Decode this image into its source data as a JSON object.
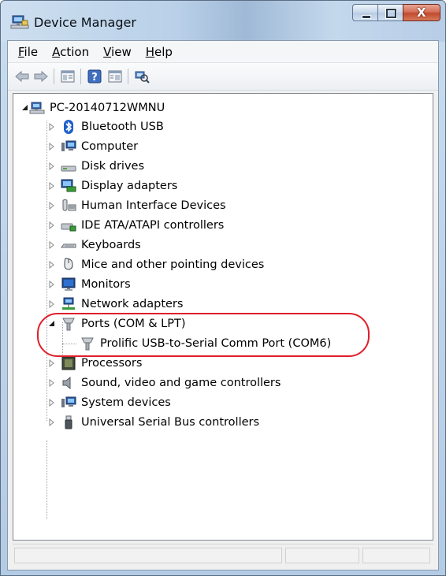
{
  "window": {
    "title": "Device Manager",
    "icons": {
      "title": "device-manager-icon"
    }
  },
  "caption_buttons": {
    "close_glyph": "X"
  },
  "menubar": {
    "items": [
      {
        "accel": "F",
        "rest": "ile"
      },
      {
        "accel": "A",
        "rest": "ction"
      },
      {
        "accel": "V",
        "rest": "iew"
      },
      {
        "accel": "H",
        "rest": "elp"
      }
    ]
  },
  "toolbar": {
    "buttons": [
      "back-arrow-icon",
      "forward-arrow-icon",
      "properties-icon",
      "help-icon",
      "show-hide-console-tree-icon",
      "scan-hardware-icon"
    ]
  },
  "tree": {
    "root": {
      "label": "PC-20140712WMNU",
      "icon": "computer-network-icon",
      "expanded": true
    },
    "categories": [
      {
        "label": "Bluetooth USB",
        "icon": "bluetooth-icon"
      },
      {
        "label": "Computer",
        "icon": "computer-icon"
      },
      {
        "label": "Disk drives",
        "icon": "disk-drive-icon"
      },
      {
        "label": "Display adapters",
        "icon": "display-adapter-icon"
      },
      {
        "label": "Human Interface Devices",
        "icon": "hid-icon"
      },
      {
        "label": "IDE ATA/ATAPI controllers",
        "icon": "ide-controller-icon"
      },
      {
        "label": "Keyboards",
        "icon": "keyboard-icon"
      },
      {
        "label": "Mice and other pointing devices",
        "icon": "mouse-icon"
      },
      {
        "label": "Monitors",
        "icon": "monitor-icon"
      },
      {
        "label": "Network adapters",
        "icon": "network-adapter-icon"
      },
      {
        "label": "Ports (COM & LPT)",
        "icon": "port-icon",
        "expanded": true
      },
      {
        "label": "Processors",
        "icon": "processor-icon"
      },
      {
        "label": "Sound, video and game controllers",
        "icon": "speaker-icon"
      },
      {
        "label": "System devices",
        "icon": "system-device-icon"
      },
      {
        "label": "Universal Serial Bus controllers",
        "icon": "usb-icon"
      }
    ],
    "port_child": {
      "label": "Prolific USB-to-Serial Comm Port (COM6)",
      "icon": "port-icon"
    }
  },
  "colors": {
    "highlight": "#e01e2a",
    "tree_line": "#9aa0a6",
    "close_button": "#c14a2f"
  }
}
